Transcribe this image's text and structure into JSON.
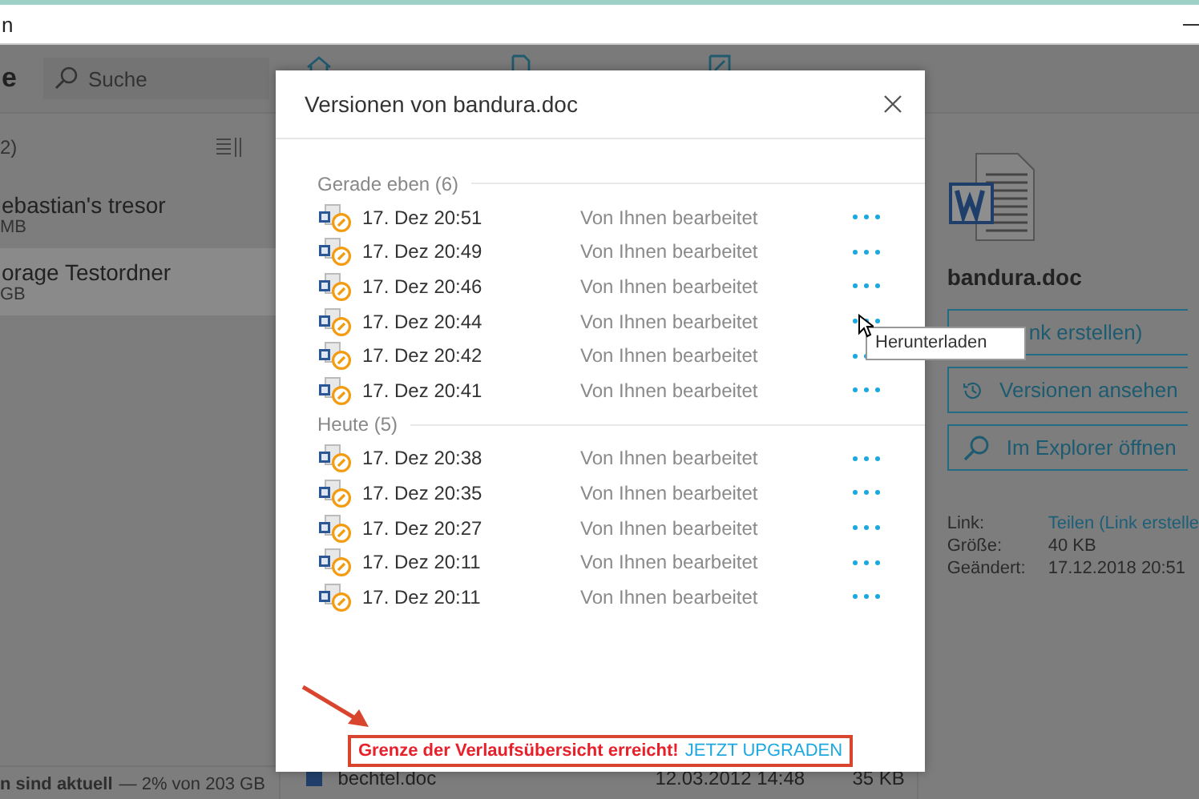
{
  "window": {
    "title": "n"
  },
  "toolbar": {
    "app_title": "e",
    "search": {
      "placeholder": "Suche"
    }
  },
  "left_panel": {
    "header": "2)",
    "items": [
      {
        "name": "ebastian's tresor",
        "size": "MB",
        "selected": false
      },
      {
        "name": "orage Testordner",
        "size": "GB",
        "selected": true
      }
    ],
    "status": {
      "text": "n sind aktuell",
      "usage": "— 2% von 203 GB"
    }
  },
  "file_list": {
    "rows": [
      {
        "name": "bechtel.doc",
        "modified": "12.03.2012 14:48",
        "size": "35 KB"
      }
    ]
  },
  "details": {
    "file_name": "bandura.doc",
    "buttons": [
      {
        "label": "nk erstellen)",
        "kind": "link"
      },
      {
        "label": "Versionen ansehen",
        "kind": "history"
      },
      {
        "label": "Im Explorer öffnen",
        "kind": "search"
      }
    ],
    "info": [
      {
        "label": "Link:",
        "value": "Teilen (Link erstelle",
        "kind": "link"
      },
      {
        "label": "Größe:",
        "value": "40 KB",
        "kind": "text"
      },
      {
        "label": "Geändert:",
        "value": "17.12.2018 20:51",
        "kind": "text"
      }
    ]
  },
  "dialog": {
    "title": "Versionen von bandura.doc",
    "groups": [
      {
        "header": "Gerade eben (6)",
        "rows": [
          {
            "time": "17. Dez 20:51",
            "editor": "Von Ihnen bearbeitet"
          },
          {
            "time": "17. Dez 20:49",
            "editor": "Von Ihnen bearbeitet"
          },
          {
            "time": "17. Dez 20:46",
            "editor": "Von Ihnen bearbeitet"
          },
          {
            "time": "17. Dez 20:44",
            "editor": "Von Ihnen bearbeitet"
          },
          {
            "time": "17. Dez 20:42",
            "editor": "Von Ihnen bearbeitet"
          },
          {
            "time": "17. Dez 20:41",
            "editor": "Von Ihnen bearbeitet"
          }
        ]
      },
      {
        "header": "Heute (5)",
        "rows": [
          {
            "time": "17. Dez 20:38",
            "editor": "Von Ihnen bearbeitet"
          },
          {
            "time": "17. Dez 20:35",
            "editor": "Von Ihnen bearbeitet"
          },
          {
            "time": "17. Dez 20:27",
            "editor": "Von Ihnen bearbeitet"
          },
          {
            "time": "17. Dez 20:11",
            "editor": "Von Ihnen bearbeitet"
          },
          {
            "time": "17. Dez 20:11",
            "editor": "Von Ihnen bearbeitet"
          }
        ]
      }
    ],
    "footer": {
      "warning": "Grenze der Verlaufsübersicht erreicht!",
      "link": "JETZT UPGRADEN"
    }
  },
  "tooltip": {
    "text": "Herunterladen"
  }
}
